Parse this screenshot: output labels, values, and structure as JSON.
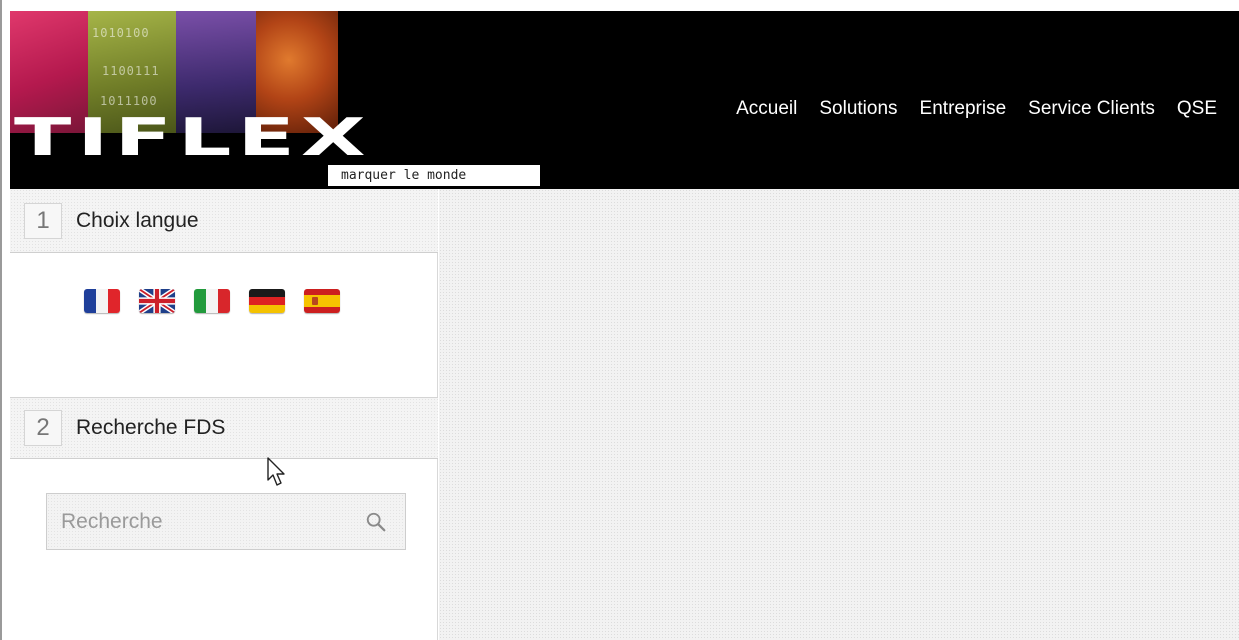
{
  "header": {
    "logo": {
      "word": "TIFLEX",
      "tagline": "marquer le monde",
      "binary_lines": [
        "1010100",
        "1100111",
        "1011100"
      ]
    },
    "nav": [
      {
        "label": "Accueil"
      },
      {
        "label": "Solutions"
      },
      {
        "label": "Entreprise"
      },
      {
        "label": "Service Clients"
      },
      {
        "label": "QSE"
      }
    ]
  },
  "sidebar": {
    "language_panel": {
      "number": "1",
      "title": "Choix langue",
      "flags": [
        {
          "icon": "flag-fr-icon"
        },
        {
          "icon": "flag-uk-icon"
        },
        {
          "icon": "flag-it-icon"
        },
        {
          "icon": "flag-de-icon"
        },
        {
          "icon": "flag-es-icon"
        }
      ]
    },
    "search_panel": {
      "number": "2",
      "title": "Recherche FDS",
      "search": {
        "placeholder": "Recherche",
        "value": "",
        "icon": "search-icon"
      }
    }
  },
  "colors": {
    "header_bg": "#000000",
    "nav_text": "#ffffff",
    "panel_text": "#222222"
  }
}
